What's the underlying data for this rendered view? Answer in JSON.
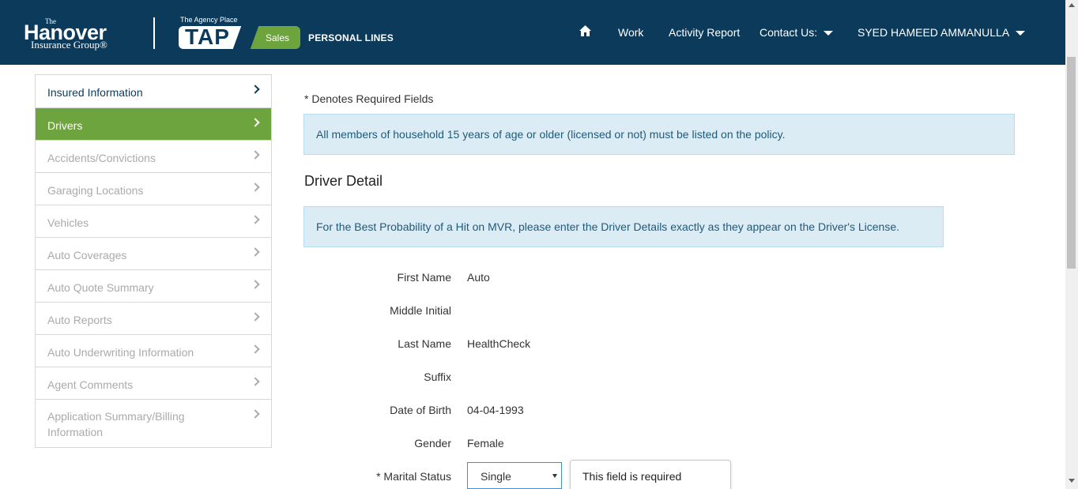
{
  "header": {
    "logo_the": "The",
    "logo_name": "Hanover",
    "logo_sub": "Insurance Group®",
    "tap_tagline": "The Agency Place",
    "tap_text": "TAP",
    "sales": "Sales",
    "personal_lines": "PERSONAL LINES",
    "nav": {
      "home_icon": "home-icon",
      "work": "Work",
      "activity_report": "Activity Report",
      "contact_us": "Contact Us:",
      "user": "SYED HAMEED AMMANULLA"
    }
  },
  "sidebar": {
    "items": [
      {
        "label": "Insured Information"
      },
      {
        "label": "Drivers"
      },
      {
        "label": "Accidents/Convictions"
      },
      {
        "label": "Garaging Locations"
      },
      {
        "label": "Vehicles"
      },
      {
        "label": "Auto Coverages"
      },
      {
        "label": "Auto Quote Summary"
      },
      {
        "label": "Auto Reports"
      },
      {
        "label": "Auto Underwriting Information"
      },
      {
        "label": "Agent Comments"
      },
      {
        "label": "Application Summary/Billing Information"
      }
    ]
  },
  "main": {
    "required_note": "* Denotes Required Fields",
    "household_alert": "All members of household 15 years of age or older (licensed or not) must be listed on the policy.",
    "section_title": "Driver Detail",
    "mvr_alert": "For the Best Probability of a Hit on MVR, please enter the Driver Details exactly as they appear on the Driver's License.",
    "fields": {
      "first_name": {
        "label": "First Name",
        "value": "Auto"
      },
      "middle_initial": {
        "label": "Middle Initial",
        "value": ""
      },
      "last_name": {
        "label": "Last Name",
        "value": "HealthCheck"
      },
      "suffix": {
        "label": "Suffix",
        "value": ""
      },
      "dob": {
        "label": "Date of Birth",
        "value": "04-04-1993"
      },
      "gender": {
        "label": "Gender",
        "value": "Female"
      },
      "marital_status": {
        "label": "* Marital Status",
        "value": "Single"
      }
    },
    "validation_tooltip": "This field is required"
  },
  "colors": {
    "header_bg": "#0b3a5b",
    "accent_green": "#6ea43d",
    "alert_bg": "#dcecf5"
  }
}
